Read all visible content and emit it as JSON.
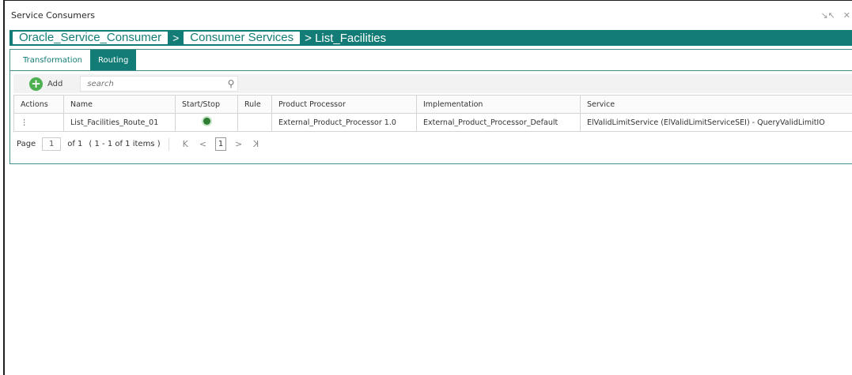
{
  "window": {
    "title": "Service Consumers",
    "controls": [
      "↘↖",
      "✕"
    ]
  },
  "breadcrumb": {
    "items": [
      "Oracle_Service_Consumer",
      "Consumer Services"
    ],
    "separator": ">",
    "current": "> List_Facilities"
  },
  "tabs": [
    {
      "label": "Transformation",
      "active": false
    },
    {
      "label": "Routing",
      "active": true
    }
  ],
  "toolbar": {
    "add_label": "Add",
    "search_placeholder": "search"
  },
  "table": {
    "columns": [
      "Actions",
      "Name",
      "Start/Stop",
      "Rule",
      "Product Processor",
      "Implementation",
      "Service"
    ],
    "rows": [
      {
        "actions": "⋮",
        "name": "List_Facilities_Route_01",
        "status": "running",
        "rule": "",
        "product_processor": "External_Product_Processor 1.0",
        "implementation": "External_Product_Processor_Default",
        "service": "ElValidLimitService (ElValidLimitServiceSEI) - QueryValidLimitIO"
      }
    ]
  },
  "pager": {
    "page_label": "Page",
    "page_value": "1",
    "of_label": "of 1",
    "items_label": "( 1 - 1 of 1 items )",
    "current_page": "1",
    "first": "K",
    "prev": "<",
    "next": ">",
    "last": "K"
  },
  "colors": {
    "accent": "#137c77",
    "status_on": "#2e7d32",
    "add": "#4caf50"
  }
}
